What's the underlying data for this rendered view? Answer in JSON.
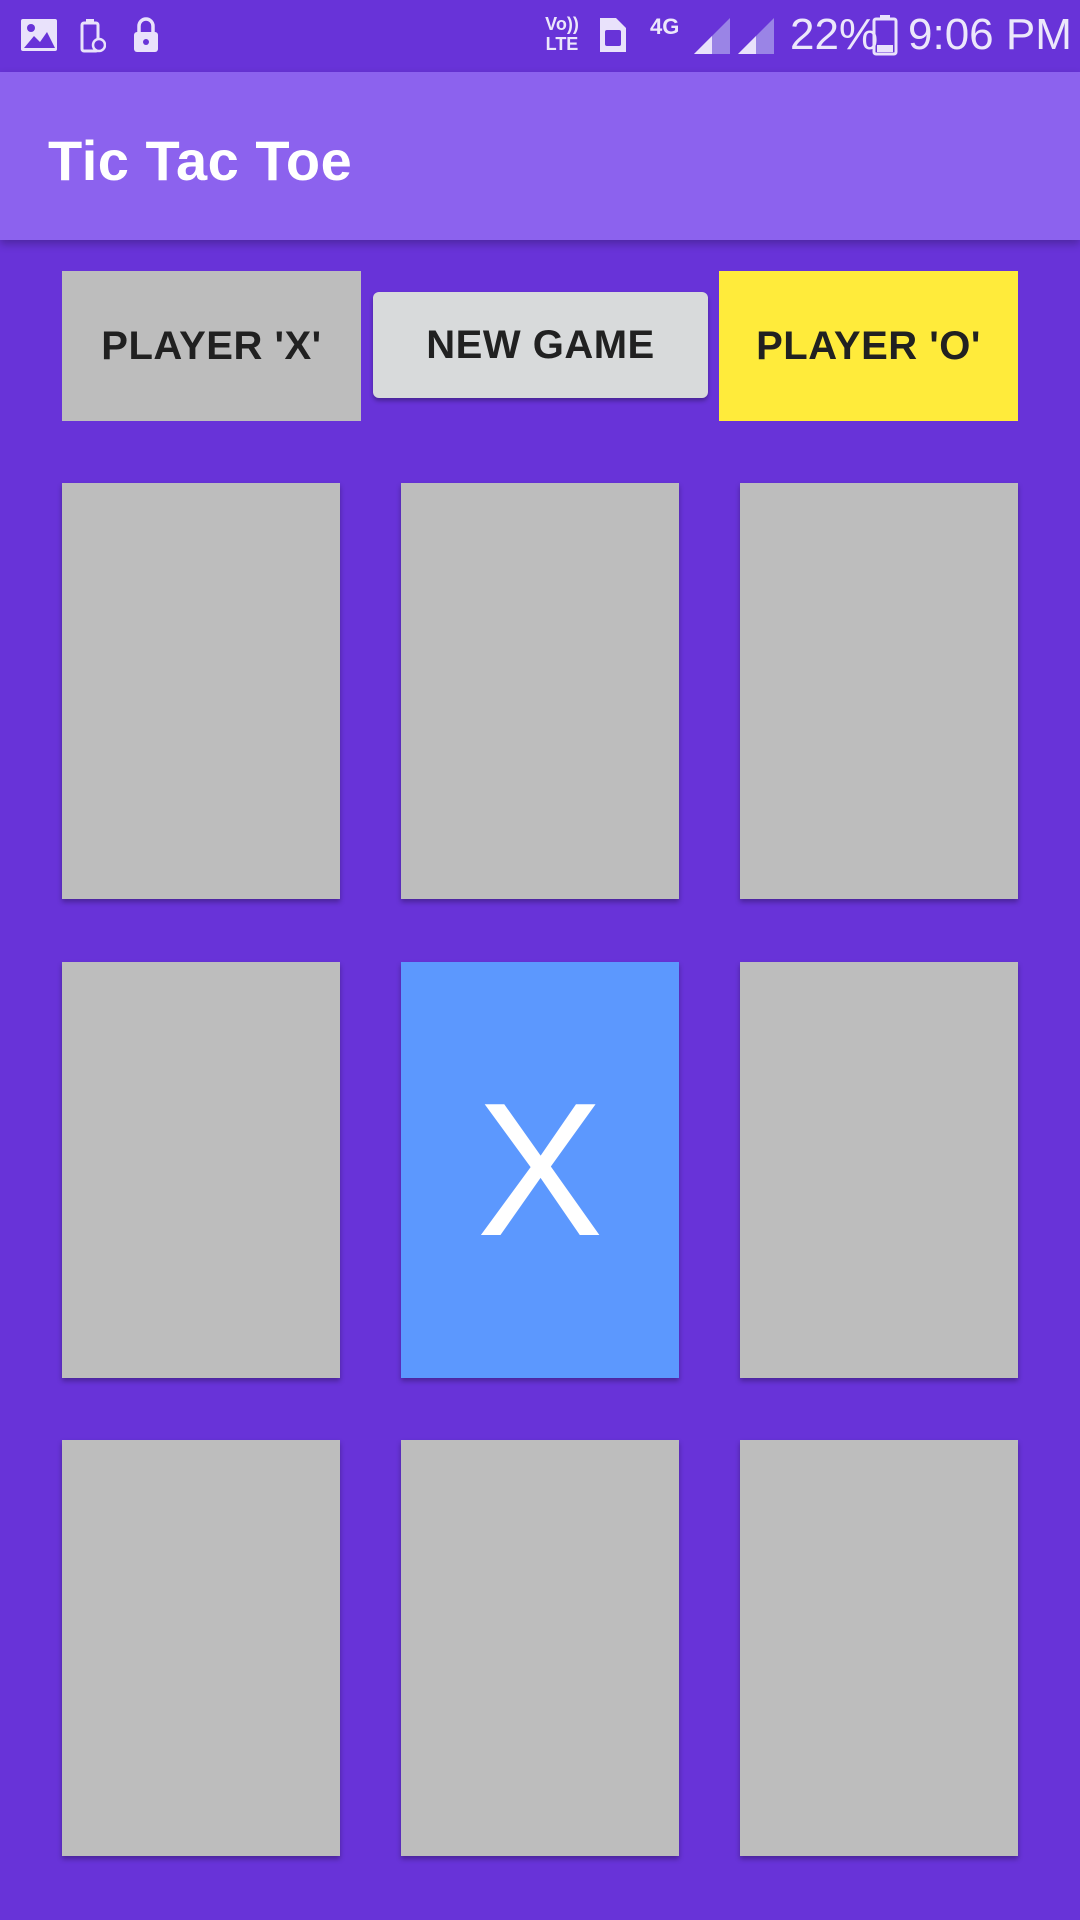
{
  "status_bar": {
    "network": "LTE",
    "network_type": "4G",
    "battery": "22%",
    "time": "9:06 PM",
    "icons": [
      "image-icon",
      "battery-saver-icon",
      "lock-icon",
      "volte-icon",
      "sim-icon",
      "signal-icon",
      "battery-icon"
    ]
  },
  "app": {
    "title": "Tic Tac Toe"
  },
  "controls": {
    "player_x": "PLAYER 'X'",
    "new_game": "NEW GAME",
    "player_o": "PLAYER 'O'"
  },
  "colors": {
    "background": "#6833d8",
    "app_bar": "#8c62ee",
    "cell": "#bdbdbd",
    "cell_filled": "#5c98fe",
    "active_player": "#ffeb3b"
  },
  "board": {
    "cells": [
      "",
      "",
      "",
      "",
      "X",
      "",
      "",
      "",
      ""
    ]
  }
}
